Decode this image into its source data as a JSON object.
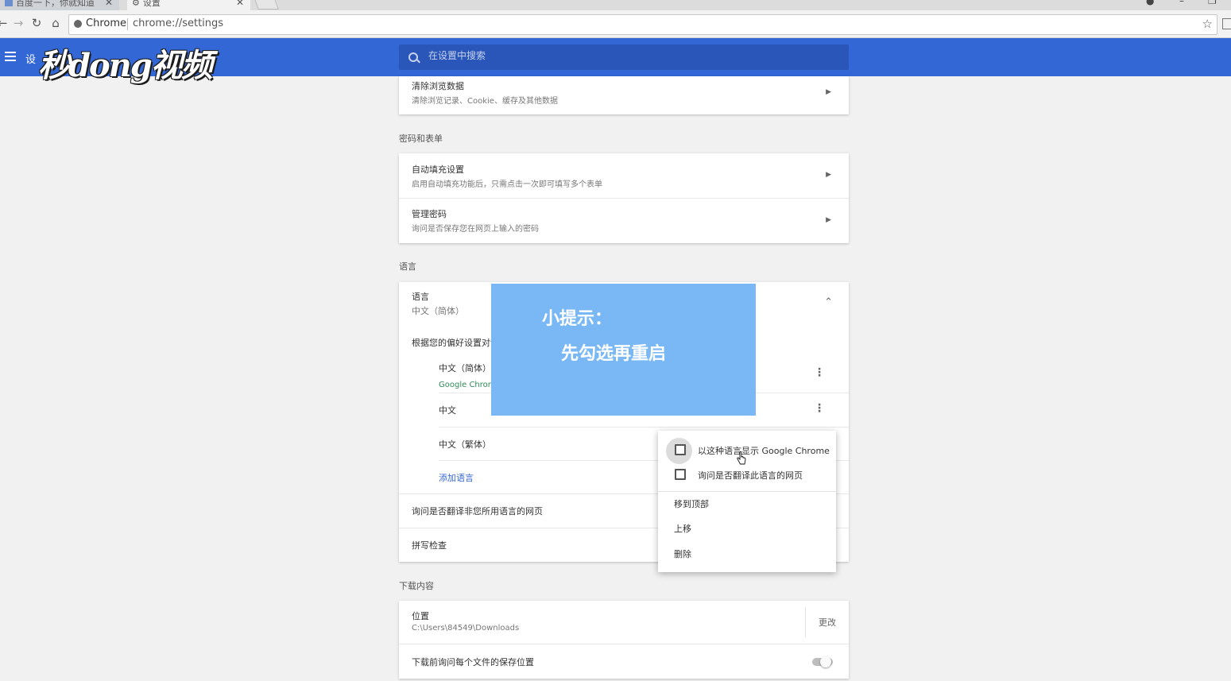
{
  "browser": {
    "tabs": [
      {
        "title": "百度一下，你就知道"
      },
      {
        "title": "设置"
      }
    ],
    "omnibox": {
      "site": "Chrome",
      "url": "chrome://settings"
    }
  },
  "header": {
    "title": "设",
    "search_placeholder": "在设置中搜索"
  },
  "watermark": {
    "text": "秒dong视频"
  },
  "privacy_card": {
    "clear_title": "清除浏览数据",
    "clear_sub": "清除浏览记录、Cookie、缓存及其他数据"
  },
  "passwords": {
    "section_label": "密码和表单",
    "autofill_title": "自动填充设置",
    "autofill_sub": "启用自动填充功能后，只需点击一次即可填写多个表单",
    "manage_title": "管理密码",
    "manage_sub": "询问是否保存您在网页上输入的密码"
  },
  "languages": {
    "section_label": "语言",
    "title": "语言",
    "current": "中文（简体）",
    "order_text": "根据您的偏好设置对语言进行排序",
    "items": [
      {
        "name": "中文（简体）",
        "sub": "Google Chrome 以这种语言显示"
      },
      {
        "name": "中文"
      },
      {
        "name": "中文（繁体）"
      }
    ],
    "add_link": "添加语言",
    "translate_offer": "询问是否翻译非您所用语言的网页",
    "spellcheck": "拼写检查"
  },
  "popup": {
    "checkbox1": "以这种语言显示 Google Chrome",
    "checkbox2": "询问是否翻译此语言的网页",
    "move_top": "移到顶部",
    "move_up": "上移",
    "remove": "删除"
  },
  "downloads": {
    "section_label": "下载内容",
    "location_title": "位置",
    "location_path": "C:\\Users\\84549\\Downloads",
    "change_button": "更改",
    "ask_location": "下载前询问每个文件的保存位置"
  },
  "tip": {
    "title": "小提示：",
    "body": "先勾选再重启"
  },
  "colors": {
    "header_blue": "#3367d6",
    "tip_blue": "#7ab8f5",
    "link_blue": "#3367d6"
  }
}
